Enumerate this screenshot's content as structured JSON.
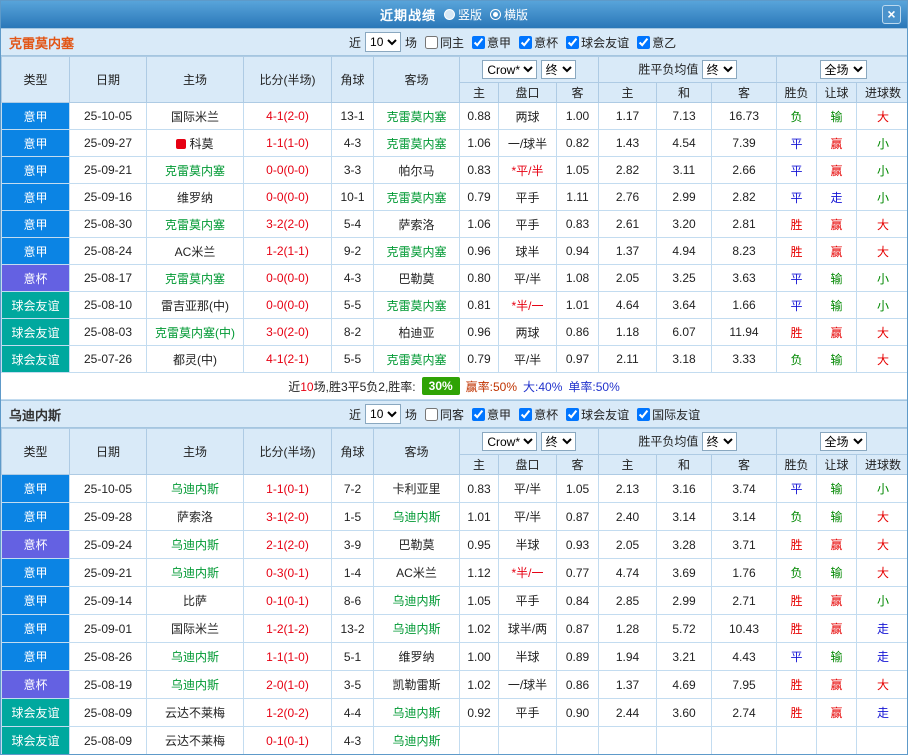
{
  "topbar": {
    "title": "近期战绩",
    "vertical": "竖版",
    "horizontal": "横版",
    "close": "×"
  },
  "colors": {
    "team_green": "#009933",
    "score_red": "#e60012",
    "handicap_star": "#e60012",
    "topbar_blue": "#2a77b8",
    "header_bg": "#d9eaf8",
    "summary_badge_green": "#2fa305"
  },
  "league_colors": {
    "意甲": "#0b84e4",
    "意杯": "#6461e2",
    "球会友谊": "#00a89e"
  },
  "result_colors": {
    "胜": "#e60000",
    "负": "#008800",
    "平": "#1414d4",
    "赢": "#e60000",
    "输": "#008800",
    "走": "#1414d4",
    "大": "#e60000",
    "小": "#008800"
  },
  "sections": [
    {
      "team": "克雷莫内塞",
      "team_color": "#e25617",
      "filters": {
        "near": "近",
        "count": "10",
        "games": "场",
        "same_label": "同主",
        "same_checked": false,
        "leagues": [
          {
            "label": "意甲",
            "checked": true
          },
          {
            "label": "意杯",
            "checked": true
          },
          {
            "label": "球会友谊",
            "checked": true
          },
          {
            "label": "意乙",
            "checked": true
          }
        ]
      },
      "header": {
        "type": "类型",
        "date": "日期",
        "home": "主场",
        "score": "比分(半场)",
        "corner": "角球",
        "away": "客场",
        "odds_source": "Crow*",
        "odds_final": "终",
        "avg_title": "胜平负均值",
        "avg_final": "终",
        "scope": "全场",
        "sub_home": "主",
        "sub_handicap": "盘口",
        "sub_away": "客",
        "sub_avg_home": "主",
        "sub_avg_draw": "和",
        "sub_avg_away": "客",
        "sub_result": "胜负",
        "sub_handicap_result": "让球",
        "sub_goals": "进球数"
      },
      "rows": [
        {
          "league": "意甲",
          "date": "25-10-05",
          "home": "国际米兰",
          "score": "4-1(2-0)",
          "corner": "13-1",
          "away": "克雷莫内塞",
          "odds": [
            "0.88",
            "两球",
            "1.00"
          ],
          "avg": [
            "1.17",
            "7.13",
            "16.73"
          ],
          "outcome": [
            "负",
            "输",
            "大"
          ]
        },
        {
          "league": "意甲",
          "date": "25-09-27",
          "home": "科莫",
          "home_live": true,
          "score": "1-1(1-0)",
          "corner": "4-3",
          "away": "克雷莫内塞",
          "odds": [
            "1.06",
            "一/球半",
            "0.82"
          ],
          "avg": [
            "1.43",
            "4.54",
            "7.39"
          ],
          "outcome": [
            "平",
            "赢",
            "小"
          ]
        },
        {
          "league": "意甲",
          "date": "25-09-21",
          "home": "克雷莫内塞",
          "score": "0-0(0-0)",
          "corner": "3-3",
          "away": "帕尔马",
          "odds": [
            "0.83",
            "*平/半",
            "1.05"
          ],
          "avg": [
            "2.82",
            "3.11",
            "2.66"
          ],
          "outcome": [
            "平",
            "赢",
            "小"
          ]
        },
        {
          "league": "意甲",
          "date": "25-09-16",
          "home": "维罗纳",
          "score": "0-0(0-0)",
          "corner": "10-1",
          "away": "克雷莫内塞",
          "odds": [
            "0.79",
            "平手",
            "1.11"
          ],
          "avg": [
            "2.76",
            "2.99",
            "2.82"
          ],
          "outcome": [
            "平",
            "走",
            "小"
          ]
        },
        {
          "league": "意甲",
          "date": "25-08-30",
          "home": "克雷莫内塞",
          "score": "3-2(2-0)",
          "corner": "5-4",
          "away": "萨索洛",
          "odds": [
            "1.06",
            "平手",
            "0.83"
          ],
          "avg": [
            "2.61",
            "3.20",
            "2.81"
          ],
          "outcome": [
            "胜",
            "赢",
            "大"
          ]
        },
        {
          "league": "意甲",
          "date": "25-08-24",
          "home": "AC米兰",
          "score": "1-2(1-1)",
          "corner": "9-2",
          "away": "克雷莫内塞",
          "odds": [
            "0.96",
            "球半",
            "0.94"
          ],
          "avg": [
            "1.37",
            "4.94",
            "8.23"
          ],
          "outcome": [
            "胜",
            "赢",
            "大"
          ]
        },
        {
          "league": "意杯",
          "date": "25-08-17",
          "home": "克雷莫内塞",
          "score": "0-0(0-0)",
          "corner": "4-3",
          "away": "巴勒莫",
          "odds": [
            "0.80",
            "平/半",
            "1.08"
          ],
          "avg": [
            "2.05",
            "3.25",
            "3.63"
          ],
          "outcome": [
            "平",
            "输",
            "小"
          ]
        },
        {
          "league": "球会友谊",
          "date": "25-08-10",
          "home": "雷吉亚那(中)",
          "score": "0-0(0-0)",
          "corner": "5-5",
          "away": "克雷莫内塞",
          "odds": [
            "0.81",
            "*半/一",
            "1.01"
          ],
          "avg": [
            "4.64",
            "3.64",
            "1.66"
          ],
          "outcome": [
            "平",
            "输",
            "小"
          ]
        },
        {
          "league": "球会友谊",
          "date": "25-08-03",
          "home": "克雷莫内塞(中)",
          "score": "3-0(2-0)",
          "corner": "8-2",
          "away": "柏迪亚",
          "odds": [
            "0.96",
            "两球",
            "0.86"
          ],
          "avg": [
            "1.18",
            "6.07",
            "11.94"
          ],
          "outcome": [
            "胜",
            "赢",
            "大"
          ]
        },
        {
          "league": "球会友谊",
          "date": "25-07-26",
          "home": "都灵(中)",
          "score": "4-1(2-1)",
          "corner": "5-5",
          "away": "克雷莫内塞",
          "odds": [
            "0.79",
            "平/半",
            "0.97"
          ],
          "avg": [
            "2.11",
            "3.18",
            "3.33"
          ],
          "outcome": [
            "负",
            "输",
            "大"
          ]
        }
      ],
      "summary": {
        "prefix": "近",
        "count": "10",
        "mid": "场,胜3平5负2,胜率:",
        "rate": "30%",
        "win_rate": "赢率:50%",
        "big_rate": "大:40%",
        "single_rate": "单率:50%"
      }
    },
    {
      "team": "乌迪内斯",
      "team_color": "#333333",
      "filters": {
        "near": "近",
        "count": "10",
        "games": "场",
        "same_label": "同客",
        "same_checked": false,
        "leagues": [
          {
            "label": "意甲",
            "checked": true
          },
          {
            "label": "意杯",
            "checked": true
          },
          {
            "label": "球会友谊",
            "checked": true
          },
          {
            "label": "国际友谊",
            "checked": true
          }
        ]
      },
      "header": {
        "type": "类型",
        "date": "日期",
        "home": "主场",
        "score": "比分(半场)",
        "corner": "角球",
        "away": "客场",
        "odds_source": "Crow*",
        "odds_final": "终",
        "avg_title": "胜平负均值",
        "avg_final": "终",
        "scope": "全场",
        "sub_home": "主",
        "sub_handicap": "盘口",
        "sub_away": "客",
        "sub_avg_home": "主",
        "sub_avg_draw": "和",
        "sub_avg_away": "客",
        "sub_result": "胜负",
        "sub_handicap_result": "让球",
        "sub_goals": "进球数"
      },
      "rows": [
        {
          "league": "意甲",
          "date": "25-10-05",
          "home": "乌迪内斯",
          "score": "1-1(0-1)",
          "corner": "7-2",
          "away": "卡利亚里",
          "odds": [
            "0.83",
            "平/半",
            "1.05"
          ],
          "avg": [
            "2.13",
            "3.16",
            "3.74"
          ],
          "outcome": [
            "平",
            "输",
            "小"
          ]
        },
        {
          "league": "意甲",
          "date": "25-09-28",
          "home": "萨索洛",
          "score": "3-1(2-0)",
          "corner": "1-5",
          "away": "乌迪内斯",
          "odds": [
            "1.01",
            "平/半",
            "0.87"
          ],
          "avg": [
            "2.40",
            "3.14",
            "3.14"
          ],
          "outcome": [
            "负",
            "输",
            "大"
          ]
        },
        {
          "league": "意杯",
          "date": "25-09-24",
          "home": "乌迪内斯",
          "score": "2-1(2-0)",
          "corner": "3-9",
          "away": "巴勒莫",
          "odds": [
            "0.95",
            "半球",
            "0.93"
          ],
          "avg": [
            "2.05",
            "3.28",
            "3.71"
          ],
          "outcome": [
            "胜",
            "赢",
            "大"
          ]
        },
        {
          "league": "意甲",
          "date": "25-09-21",
          "home": "乌迪内斯",
          "score": "0-3(0-1)",
          "corner": "1-4",
          "away": "AC米兰",
          "odds": [
            "1.12",
            "*半/一",
            "0.77"
          ],
          "avg": [
            "4.74",
            "3.69",
            "1.76"
          ],
          "outcome": [
            "负",
            "输",
            "大"
          ]
        },
        {
          "league": "意甲",
          "date": "25-09-14",
          "home": "比萨",
          "score": "0-1(0-1)",
          "corner": "8-6",
          "away": "乌迪内斯",
          "odds": [
            "1.05",
            "平手",
            "0.84"
          ],
          "avg": [
            "2.85",
            "2.99",
            "2.71"
          ],
          "outcome": [
            "胜",
            "赢",
            "小"
          ]
        },
        {
          "league": "意甲",
          "date": "25-09-01",
          "home": "国际米兰",
          "score": "1-2(1-2)",
          "corner": "13-2",
          "away": "乌迪内斯",
          "odds": [
            "1.02",
            "球半/两",
            "0.87"
          ],
          "avg": [
            "1.28",
            "5.72",
            "10.43"
          ],
          "outcome": [
            "胜",
            "赢",
            "走"
          ]
        },
        {
          "league": "意甲",
          "date": "25-08-26",
          "home": "乌迪内斯",
          "score": "1-1(1-0)",
          "corner": "5-1",
          "away": "维罗纳",
          "odds": [
            "1.00",
            "半球",
            "0.89"
          ],
          "avg": [
            "1.94",
            "3.21",
            "4.43"
          ],
          "outcome": [
            "平",
            "输",
            "走"
          ]
        },
        {
          "league": "意杯",
          "date": "25-08-19",
          "home": "乌迪内斯",
          "score": "2-0(1-0)",
          "corner": "3-5",
          "away": "凯勒雷斯",
          "odds": [
            "1.02",
            "一/球半",
            "0.86"
          ],
          "avg": [
            "1.37",
            "4.69",
            "7.95"
          ],
          "outcome": [
            "胜",
            "赢",
            "大"
          ]
        },
        {
          "league": "球会友谊",
          "date": "25-08-09",
          "home": "云达不莱梅",
          "score": "1-2(0-2)",
          "corner": "4-4",
          "away": "乌迪内斯",
          "odds": [
            "0.92",
            "平手",
            "0.90"
          ],
          "avg": [
            "2.44",
            "3.60",
            "2.74"
          ],
          "outcome": [
            "胜",
            "赢",
            "走"
          ]
        },
        {
          "league": "球会友谊",
          "date": "25-08-09",
          "home": "云达不莱梅",
          "score": "0-1(0-1)",
          "corner": "4-3",
          "away": "乌迪内斯",
          "odds": [
            "",
            "",
            ""
          ],
          "avg": [
            "",
            "",
            ""
          ],
          "outcome": [
            "",
            "",
            ""
          ]
        }
      ]
    }
  ]
}
